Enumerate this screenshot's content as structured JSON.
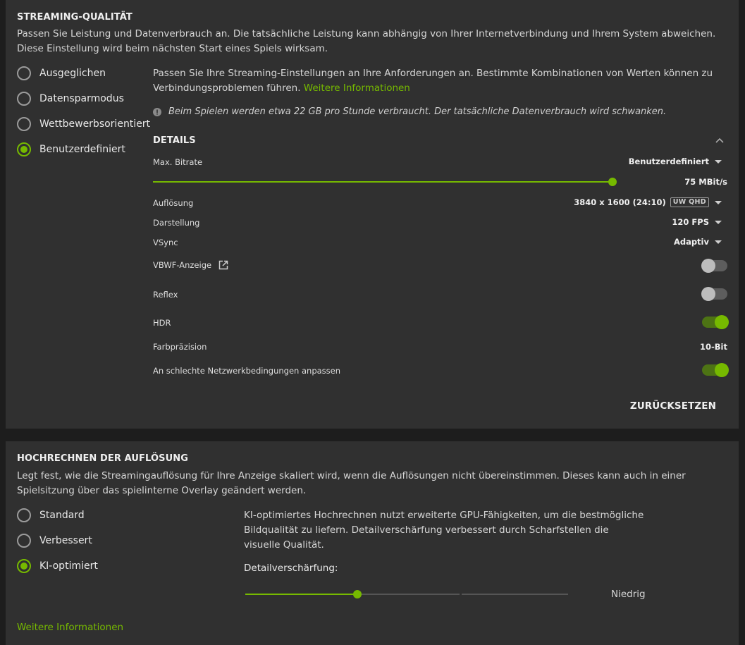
{
  "streaming": {
    "title": "STREAMING-QUALITÄT",
    "description": "Passen Sie Leistung und Datenverbrauch an. Die tatsächliche Leistung kann abhängig von Ihrer Internetverbindung und Ihrem System abweichen. Diese Einstellung wird beim nächsten Start eines Spiels wirksam.",
    "presets": [
      "Ausgeglichen",
      "Datensparmodus",
      "Wettbewerbsorientiert",
      "Benutzerdefiniert"
    ],
    "selected_preset": "Benutzerdefiniert",
    "custom_text": "Passen Sie Ihre Streaming-Einstellungen an Ihre Anforderungen an. Bestimmte Kombinationen von Werten können zu Verbindungsproblemen führen.",
    "more_info": "Weitere Informationen",
    "info_note": "Beim Spielen werden etwa 22 GB pro Stunde verbraucht. Der tatsächliche Datenverbrauch wird schwanken.",
    "details_title": "DETAILS",
    "bitrate_label": "Max. Bitrate",
    "bitrate_mode": "Benutzerdefiniert",
    "bitrate_value": "75 MBit/s",
    "bitrate_fraction": 1.0,
    "resolution_label": "Auflösung",
    "resolution_value": "3840 x 1600 (24:10)",
    "resolution_badge": "UW QHD",
    "display_label": "Darstellung",
    "display_value": "120 FPS",
    "vsync_label": "VSync",
    "vsync_value": "Adaptiv",
    "vbwf_label": "VBWF-Anzeige",
    "vbwf_on": false,
    "reflex_label": "Reflex",
    "reflex_on": false,
    "hdr_label": "HDR",
    "hdr_on": true,
    "color_label": "Farbpräzision",
    "color_value": "10-Bit",
    "network_label": "An schlechte Netzwerkbedingungen anpassen",
    "network_on": true,
    "reset_label": "ZURÜCKSETZEN"
  },
  "upscaling": {
    "title": "HOCHRECHNEN DER AUFLÖSUNG",
    "description": "Legt fest, wie die Streamingauflösung für Ihre Anzeige skaliert wird, wenn die Auflösungen nicht übereinstimmen. Dieses kann auch in einer Spielsitzung über das spielinterne Overlay geändert werden.",
    "options": [
      "Standard",
      "Verbessert",
      "KI-optimiert"
    ],
    "selected_option": "KI-optimiert",
    "ai_text": "KI-optimiertes Hochrechnen nutzt erweiterte GPU-Fähigkeiten, um die bestmögliche Bildqualität zu liefern. Detailverschärfung verbessert durch Scharfstellen die visuelle Qualität.",
    "sharpen_label": "Detailverschärfung:",
    "sharpen_value": "Niedrig",
    "sharpen_level": 1,
    "sharpen_levels": 3,
    "more_info": "Weitere Informationen"
  },
  "colors": {
    "accent": "#76b900",
    "panel": "#303030",
    "background": "#1d1d1d"
  }
}
